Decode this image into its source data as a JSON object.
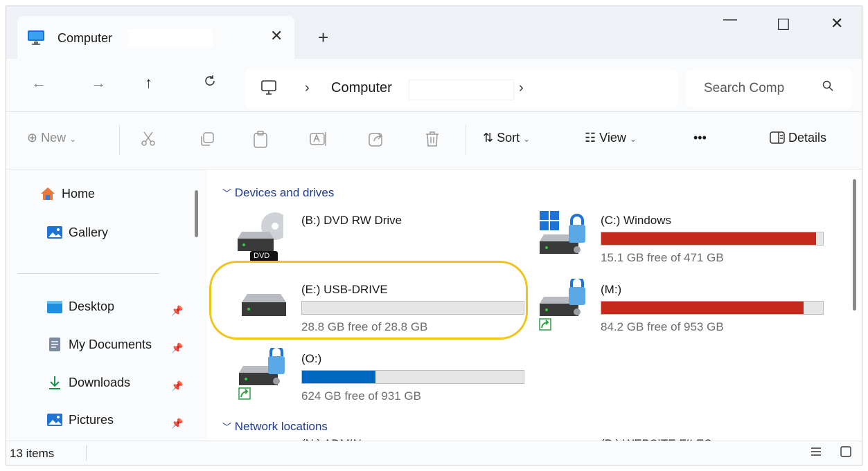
{
  "tab": {
    "title": "Computer",
    "close": "✕",
    "new_tab": "+"
  },
  "window_controls": {
    "minimize": "—",
    "maximize": "☐",
    "close": "✕"
  },
  "nav": {
    "back": "←",
    "forward": "→",
    "up": "↑",
    "refresh": "C"
  },
  "address": {
    "chevron": "›",
    "path": "Computer",
    "chevron2": "›"
  },
  "search": {
    "placeholder": "Search Comp",
    "icon": "⚲"
  },
  "toolbar": {
    "new_label": "New",
    "sort_label": "Sort",
    "view_label": "View",
    "more_label": "•••",
    "details_label": "Details",
    "dropdown_chevron": "⌄"
  },
  "sidebar": {
    "items": [
      {
        "label": "Home",
        "icon": "home-icon"
      },
      {
        "label": "Gallery",
        "icon": "gallery-icon"
      },
      {
        "label": "Desktop",
        "icon": "desktop-icon",
        "pinned": true
      },
      {
        "label": "My Documents",
        "icon": "documents-icon",
        "pinned": true
      },
      {
        "label": "Downloads",
        "icon": "downloads-icon",
        "pinned": true
      },
      {
        "label": "Pictures",
        "icon": "pictures-icon",
        "pinned": true
      }
    ]
  },
  "main": {
    "groups": [
      {
        "label": "Devices and drives"
      },
      {
        "label": "Network locations"
      }
    ],
    "drives": [
      {
        "name": "(B:) DVD RW Drive",
        "free_text": "",
        "usage": null
      },
      {
        "name": "(C:) Windows",
        "free_text": "15.1 GB free of 471 GB",
        "usage": 0.968,
        "color": "#c42b1c"
      },
      {
        "name": "(E:) USB-DRIVE",
        "free_text": "28.8 GB free of 28.8 GB",
        "usage": 0.0,
        "color": "#0067c0"
      },
      {
        "name": "(M:)",
        "free_text": "84.2 GB free of 953 GB",
        "usage": 0.912,
        "color": "#c42b1c"
      },
      {
        "name": "(O:)",
        "free_text": "624 GB free of 931 GB",
        "usage": 0.33,
        "color": "#0067c0"
      }
    ],
    "network_partial": [
      {
        "name": "(N:) ADMIN"
      },
      {
        "name": "(P:) WEBSITE FILES"
      }
    ],
    "dvd_badge": "DVD"
  },
  "status": {
    "count": "13 items"
  }
}
